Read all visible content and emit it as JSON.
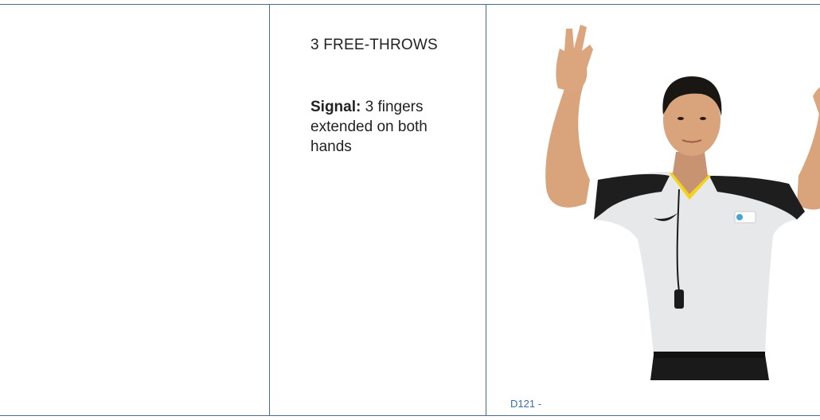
{
  "signal": {
    "title": "3 FREE-THROWS",
    "signal_label": "Signal:",
    "signal_text": " 3 fingers extended on both hands",
    "caption": "D121 -"
  },
  "colors": {
    "rule": "#4a6a8f",
    "caption": "#3b6ea5",
    "shirt": "#e6e8ea",
    "shirt_trim": "#1e1e1e",
    "collar": "#f2d21b",
    "skin": "#d9a37c"
  },
  "image": {
    "description_icon": "referee-photo"
  }
}
